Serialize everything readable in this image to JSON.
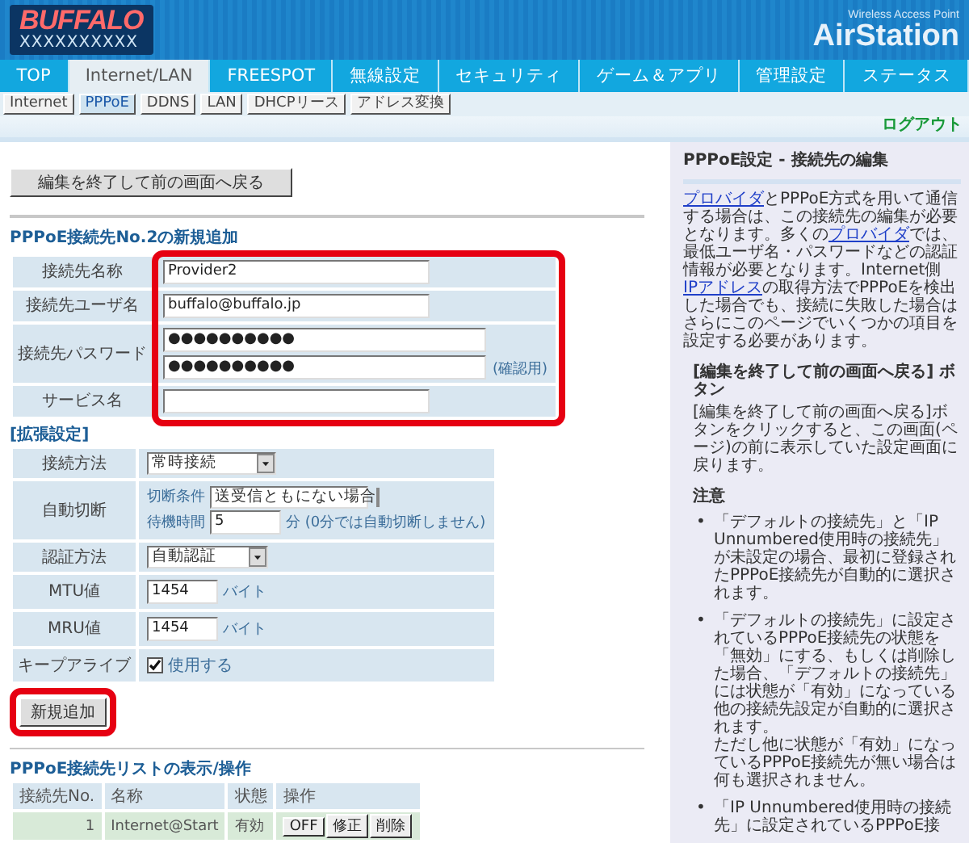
{
  "header": {
    "logo": "BUFFALO",
    "model": "XXXXXXXXXX",
    "product_line": "Wireless Access Point",
    "product": "AirStation"
  },
  "nav": [
    {
      "label": "TOP",
      "selected": false
    },
    {
      "label": "Internet/LAN",
      "selected": true
    },
    {
      "label": "FREESPOT",
      "selected": false
    },
    {
      "label": "無線設定",
      "selected": false
    },
    {
      "label": "セキュリティ",
      "selected": false
    },
    {
      "label": "ゲーム＆アプリ",
      "selected": false
    },
    {
      "label": "管理設定",
      "selected": false
    },
    {
      "label": "ステータス",
      "selected": false
    }
  ],
  "subnav": [
    {
      "label": "Internet",
      "selected": false
    },
    {
      "label": "PPPoE",
      "selected": true
    },
    {
      "label": "DDNS",
      "selected": false
    },
    {
      "label": "LAN",
      "selected": false
    },
    {
      "label": "DHCPリース",
      "selected": false
    },
    {
      "label": "アドレス変換",
      "selected": false
    }
  ],
  "logout": "ログアウト",
  "back_button": "編集を終了して前の画面へ戻る",
  "form": {
    "title": "PPPoE接続先No.2の新規追加",
    "rows": [
      {
        "label": "接続先名称",
        "kind": "text",
        "value": "Provider2"
      },
      {
        "label": "接続先ユーザ名",
        "kind": "text",
        "value": "buffalo@buffalo.jp"
      },
      {
        "label": "接続先パスワード",
        "kind": "password",
        "value": "●●●●●●●●●●",
        "confirm_value": "●●●●●●●●●●",
        "confirm_note": "(確認用)"
      },
      {
        "label": "サービス名",
        "kind": "text"
      }
    ]
  },
  "extended": {
    "title": "[拡張設定]",
    "rows": [
      {
        "label": "接続方法",
        "kind": "select",
        "value": "常時接続"
      },
      {
        "label": "自動切断",
        "kind": "disconnect",
        "condition_label": "切断条件",
        "condition": "送受信ともにない場合",
        "wait_label": "待機時間",
        "wait": "5",
        "wait_note": "分 (0分では自動切断しません)"
      },
      {
        "label": "認証方法",
        "kind": "select",
        "value": "自動認証"
      },
      {
        "label": "MTU値",
        "kind": "number",
        "value": "1454",
        "unit": "バイト"
      },
      {
        "label": "MRU値",
        "kind": "number",
        "value": "1454",
        "unit": "バイト"
      },
      {
        "label": "キープアライブ",
        "kind": "checkbox",
        "checked": true,
        "text": "使用する"
      }
    ]
  },
  "add_button": "新規追加",
  "list": {
    "title": "PPPoE接続先リストの表示/操作",
    "columns": [
      "接続先No.",
      "名称",
      "状態",
      "操作"
    ],
    "rows": [
      {
        "no": "1",
        "name": "Internet@Start",
        "status": "有効",
        "actions": [
          "OFF",
          "修正",
          "削除"
        ]
      }
    ]
  },
  "help": {
    "title": "PPPoE設定 - 接続先の編集",
    "intro": [
      {
        "text": "プロバイダ",
        "link": true
      },
      {
        "text": "とPPPoE方式を用いて通信する場合は、この接続先の編集が必要となります。多くの",
        "link": false
      },
      {
        "text": "プロバイダ",
        "link": true
      },
      {
        "text": "では、最低ユーザ名・パスワードなどの認証情報が必要となります。Internet側",
        "link": false
      },
      {
        "text": "IPアドレス",
        "link": true
      },
      {
        "text": "の取得方法でPPPoEを検出した場合でも、接続に失敗した場合はさらにこのページでいくつかの項目を設定する必要があります。",
        "link": false
      }
    ],
    "sections": [
      {
        "heading": "[編集を終了して前の画面へ戻る] ボタン",
        "body": "[編集を終了して前の画面へ戻る]ボタンをクリックすると、この画面(ページ)の前に表示していた設定画面に戻ります。"
      }
    ],
    "notes_title": "注意",
    "notes": [
      {
        "marker": "•",
        "lines": [
          "「デフォルトの接続先」と「IP Unnumbered使用時の接続先」が未設定の場合、最初に登録されたPPPoE接続先が自動的に選択されます。"
        ]
      },
      {
        "marker": "•",
        "lines": [
          "「デフォルトの接続先」に設定されているPPPoE接続先の状態を「無効」にする、もしくは削除した場合、「デフォルトの接続先」には状態が「有効」になっている他の接続先設定が自動的に選択されます。",
          "ただし他に状態が「有効」になっているPPPoE接続先が無い場合は何も選択されません。"
        ]
      },
      {
        "marker": "•",
        "lines": [
          "「IP Unnumbered使用時の接続先」に設定されているPPPoE接"
        ]
      }
    ]
  }
}
